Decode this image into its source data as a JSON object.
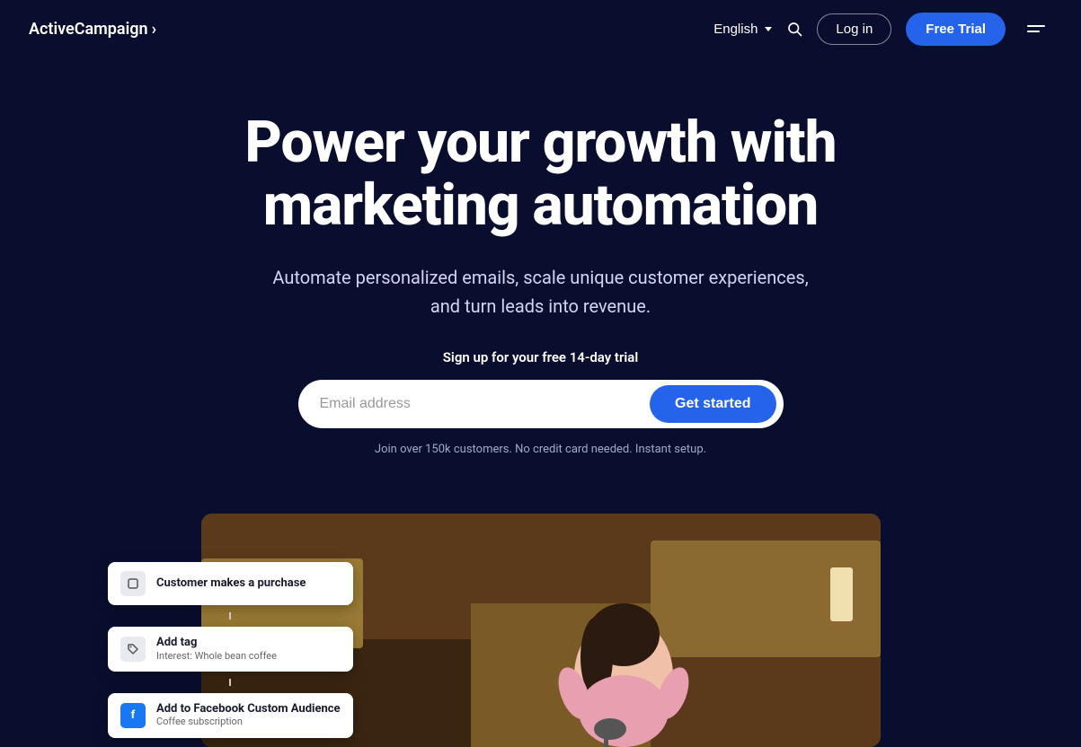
{
  "nav": {
    "logo": "ActiveCampaign",
    "logo_arrow": "›",
    "lang": "English",
    "login_label": "Log in",
    "free_trial_label": "Free Trial"
  },
  "hero": {
    "title": "Power your growth with marketing automation",
    "subtitle": "Automate personalized emails, scale unique customer experiences, and turn leads into revenue.",
    "signup_label": "Sign up for your free 14-day trial",
    "email_placeholder": "Email address",
    "cta_label": "Get started",
    "trust_text": "Join over 150k customers. No credit card needed. Instant setup."
  },
  "automation_cards": [
    {
      "icon_type": "square",
      "title": "Customer makes a purchase",
      "subtitle": ""
    },
    {
      "icon_type": "tag",
      "title": "Add tag",
      "subtitle": "Interest: Whole bean coffee"
    },
    {
      "icon_type": "fb",
      "title": "Add to Facebook Custom Audience",
      "subtitle": "Coffee subscription"
    }
  ]
}
